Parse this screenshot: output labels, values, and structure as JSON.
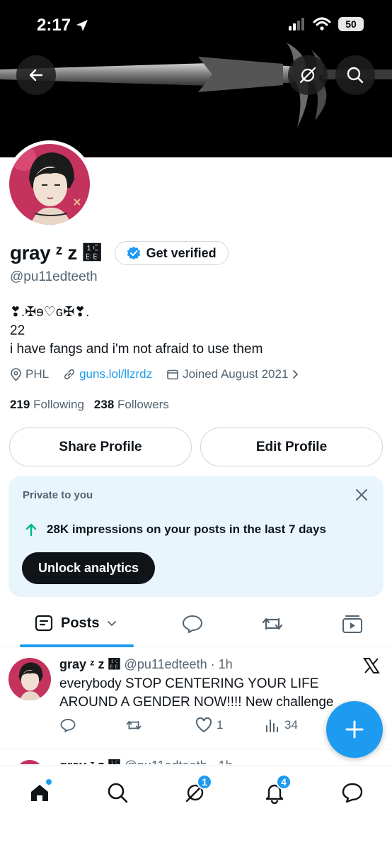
{
  "status_bar": {
    "time": "2:17",
    "battery": "50"
  },
  "profile": {
    "display_name": "gray ᶻ z ᲻",
    "verify_label": "Get verified",
    "handle": "@pu11edteeth",
    "bio_lines": [
      "❣.✠ɘ♡ɢ✠❣.",
      "22",
      "i have fangs and i'm not afraid to use them"
    ],
    "location": "PHL",
    "website": "guns.lol/llzrdz",
    "joined": "Joined August 2021",
    "following_count": "219",
    "following_label": "Following",
    "followers_count": "238",
    "followers_label": "Followers",
    "share_label": "Share Profile",
    "edit_label": "Edit Profile"
  },
  "analytics": {
    "label": "Private to you",
    "text": "28K impressions on your posts in the last 7 days",
    "button": "Unlock analytics"
  },
  "tabs": {
    "posts_label": "Posts"
  },
  "post": {
    "name": "gray ᶻ z ᲻",
    "handle_time": "@pu11edteeth · 1h",
    "text": "everybody STOP CENTERING YOUR LIFE AROUND A GENDER NOW!!!! New challenge",
    "likes": "1",
    "views": "34"
  },
  "post2": {
    "name": "gray ᶻ z ᲻",
    "handle_time": "@pu11edteeth · 1h"
  },
  "nav": {
    "grok_badge": "1",
    "notifications_badge": "4"
  },
  "colors": {
    "accent": "#1d9bf0",
    "text": "#0f1419",
    "muted": "#536471",
    "card_bg": "#e8f5fd",
    "impressions_arrow": "#00ba7c"
  }
}
